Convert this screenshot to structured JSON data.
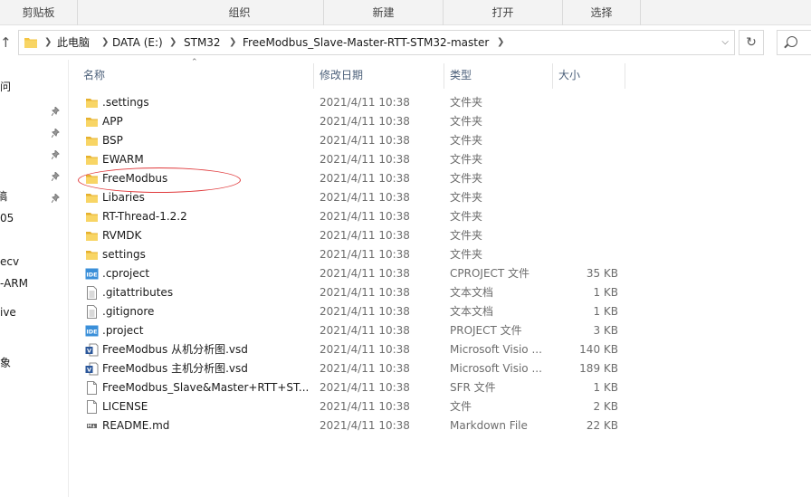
{
  "ribbon": {
    "groups": [
      "剪贴板",
      "组织",
      "新建",
      "打开",
      "选择"
    ]
  },
  "address": {
    "crumbs": [
      "此电脑",
      "DATA (E:)",
      "STM32",
      "FreeModbus_Slave-Master-RTT-STM32-master"
    ]
  },
  "navpane": {
    "items": [
      "问",
      "稿",
      "05",
      "ecv",
      "-ARM",
      "ive",
      "象"
    ]
  },
  "columns": {
    "name": "名称",
    "date": "修改日期",
    "type": "类型",
    "size": "大小"
  },
  "files": [
    {
      "name": ".settings",
      "date": "2021/4/11 10:38",
      "type": "文件夹",
      "size": "",
      "icon": "folder-icon"
    },
    {
      "name": "APP",
      "date": "2021/4/11 10:38",
      "type": "文件夹",
      "size": "",
      "icon": "folder-icon"
    },
    {
      "name": "BSP",
      "date": "2021/4/11 10:38",
      "type": "文件夹",
      "size": "",
      "icon": "folder-icon"
    },
    {
      "name": "EWARM",
      "date": "2021/4/11 10:38",
      "type": "文件夹",
      "size": "",
      "icon": "folder-icon"
    },
    {
      "name": "FreeModbus",
      "date": "2021/4/11 10:38",
      "type": "文件夹",
      "size": "",
      "icon": "folder-icon"
    },
    {
      "name": "Libaries",
      "date": "2021/4/11 10:38",
      "type": "文件夹",
      "size": "",
      "icon": "folder-icon"
    },
    {
      "name": "RT-Thread-1.2.2",
      "date": "2021/4/11 10:38",
      "type": "文件夹",
      "size": "",
      "icon": "folder-icon"
    },
    {
      "name": "RVMDK",
      "date": "2021/4/11 10:38",
      "type": "文件夹",
      "size": "",
      "icon": "folder-icon"
    },
    {
      "name": "settings",
      "date": "2021/4/11 10:38",
      "type": "文件夹",
      "size": "",
      "icon": "folder-icon"
    },
    {
      "name": ".cproject",
      "date": "2021/4/11 10:38",
      "type": "CPROJECT 文件",
      "size": "35 KB",
      "icon": "ide-icon"
    },
    {
      "name": ".gitattributes",
      "date": "2021/4/11 10:38",
      "type": "文本文档",
      "size": "1 KB",
      "icon": "text-file-icon"
    },
    {
      "name": ".gitignore",
      "date": "2021/4/11 10:38",
      "type": "文本文档",
      "size": "1 KB",
      "icon": "text-file-icon"
    },
    {
      "name": ".project",
      "date": "2021/4/11 10:38",
      "type": "PROJECT 文件",
      "size": "3 KB",
      "icon": "ide-icon"
    },
    {
      "name": "FreeModbus 从机分析图.vsd",
      "date": "2021/4/11 10:38",
      "type": "Microsoft Visio ...",
      "size": "140 KB",
      "icon": "visio-icon"
    },
    {
      "name": "FreeModbus 主机分析图.vsd",
      "date": "2021/4/11 10:38",
      "type": "Microsoft Visio ...",
      "size": "189 KB",
      "icon": "visio-icon"
    },
    {
      "name": "FreeModbus_Slave&Master+RTT+ST...",
      "date": "2021/4/11 10:38",
      "type": "SFR 文件",
      "size": "1 KB",
      "icon": "blank-file-icon"
    },
    {
      "name": "LICENSE",
      "date": "2021/4/11 10:38",
      "type": "文件",
      "size": "2 KB",
      "icon": "blank-file-icon"
    },
    {
      "name": "README.md",
      "date": "2021/4/11 10:38",
      "type": "Markdown File",
      "size": "22 KB",
      "icon": "markdown-file-icon"
    }
  ],
  "colors": {
    "folder": "#f5c542",
    "ide": "#3a8fd9",
    "visio": "#2b579a",
    "highlight": "#e0393b"
  }
}
